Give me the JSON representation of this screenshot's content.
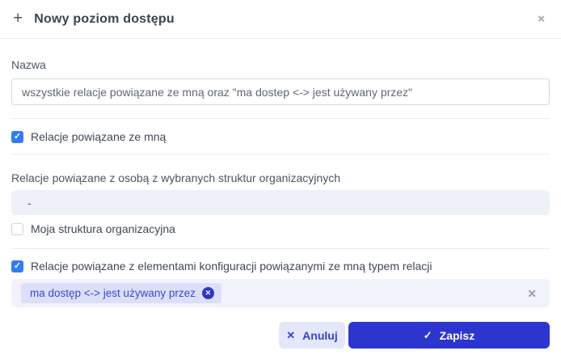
{
  "dialog": {
    "title": "Nowy poziom dostępu",
    "plus_icon": "+",
    "close_icon": "×"
  },
  "form": {
    "name_field": {
      "label": "Nazwa",
      "value": "wszystkie relacje powiązane ze mną oraz \"ma dostep <-> jest używany przez\""
    },
    "checkbox_relations_me": {
      "label": "Relacje powiązane ze mną",
      "checked": true,
      "check_glyph": "✓"
    },
    "org_structures_field": {
      "label": "Relacje powiązane z osobą z wybranych struktur organizacyjnych",
      "value": "-"
    },
    "checkbox_my_structure": {
      "label": "Moja struktura organizacyjna",
      "checked": false
    },
    "checkbox_config_items": {
      "label": "Relacje powiązane z elementami konfiguracji powiązanymi ze mną typem relacji",
      "checked": true,
      "check_glyph": "✓"
    },
    "relation_type_field": {
      "chips": [
        {
          "label": "ma dostęp <-> jest używany przez",
          "remove_glyph": "✕"
        }
      ],
      "clear_glyph": "✕"
    }
  },
  "footer": {
    "cancel_label": "Anuluj",
    "cancel_icon": "✕",
    "save_label": "Zapisz",
    "save_icon": "✓"
  },
  "colors": {
    "primary_indigo": "#2d35cf",
    "cancel_bg": "#e4e7f9",
    "checkbox_blue": "#2f7df6",
    "chip_bg": "#dbe0f8",
    "chip_text": "#3b49cf",
    "tag_field_bg": "#f1f3fc",
    "disabled_field_bg": "#eef1f9",
    "divider": "#e9ebef"
  }
}
